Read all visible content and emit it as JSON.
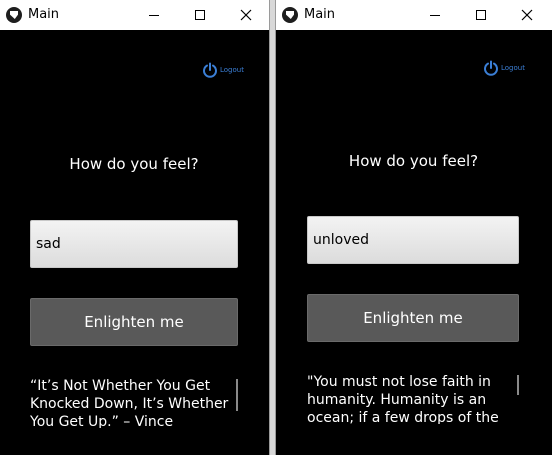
{
  "windows": [
    {
      "title": "Main",
      "logout_label": "Logout",
      "prompt": "How do you feel?",
      "input_value": "sad",
      "button_label": "Enlighten me",
      "quote": "“It’s Not Whether You Get Knocked Down, It’s Whether You Get Up.” – Vince Lombardi"
    },
    {
      "title": "Main",
      "logout_label": "Logout",
      "prompt": "How do you feel?",
      "input_value": "unloved",
      "button_label": "Enlighten me",
      "quote": "\"You must not lose faith in humanity. Humanity is an ocean; if a few drops of the ocean are dirty, the ocean does not become dirty.\""
    }
  ],
  "colors": {
    "window_bg": "#000000",
    "accent": "#3b7fd6",
    "button_bg": "#595959"
  },
  "icons": [
    "app-icon",
    "minimize-icon",
    "maximize-icon",
    "close-icon",
    "power-icon"
  ]
}
